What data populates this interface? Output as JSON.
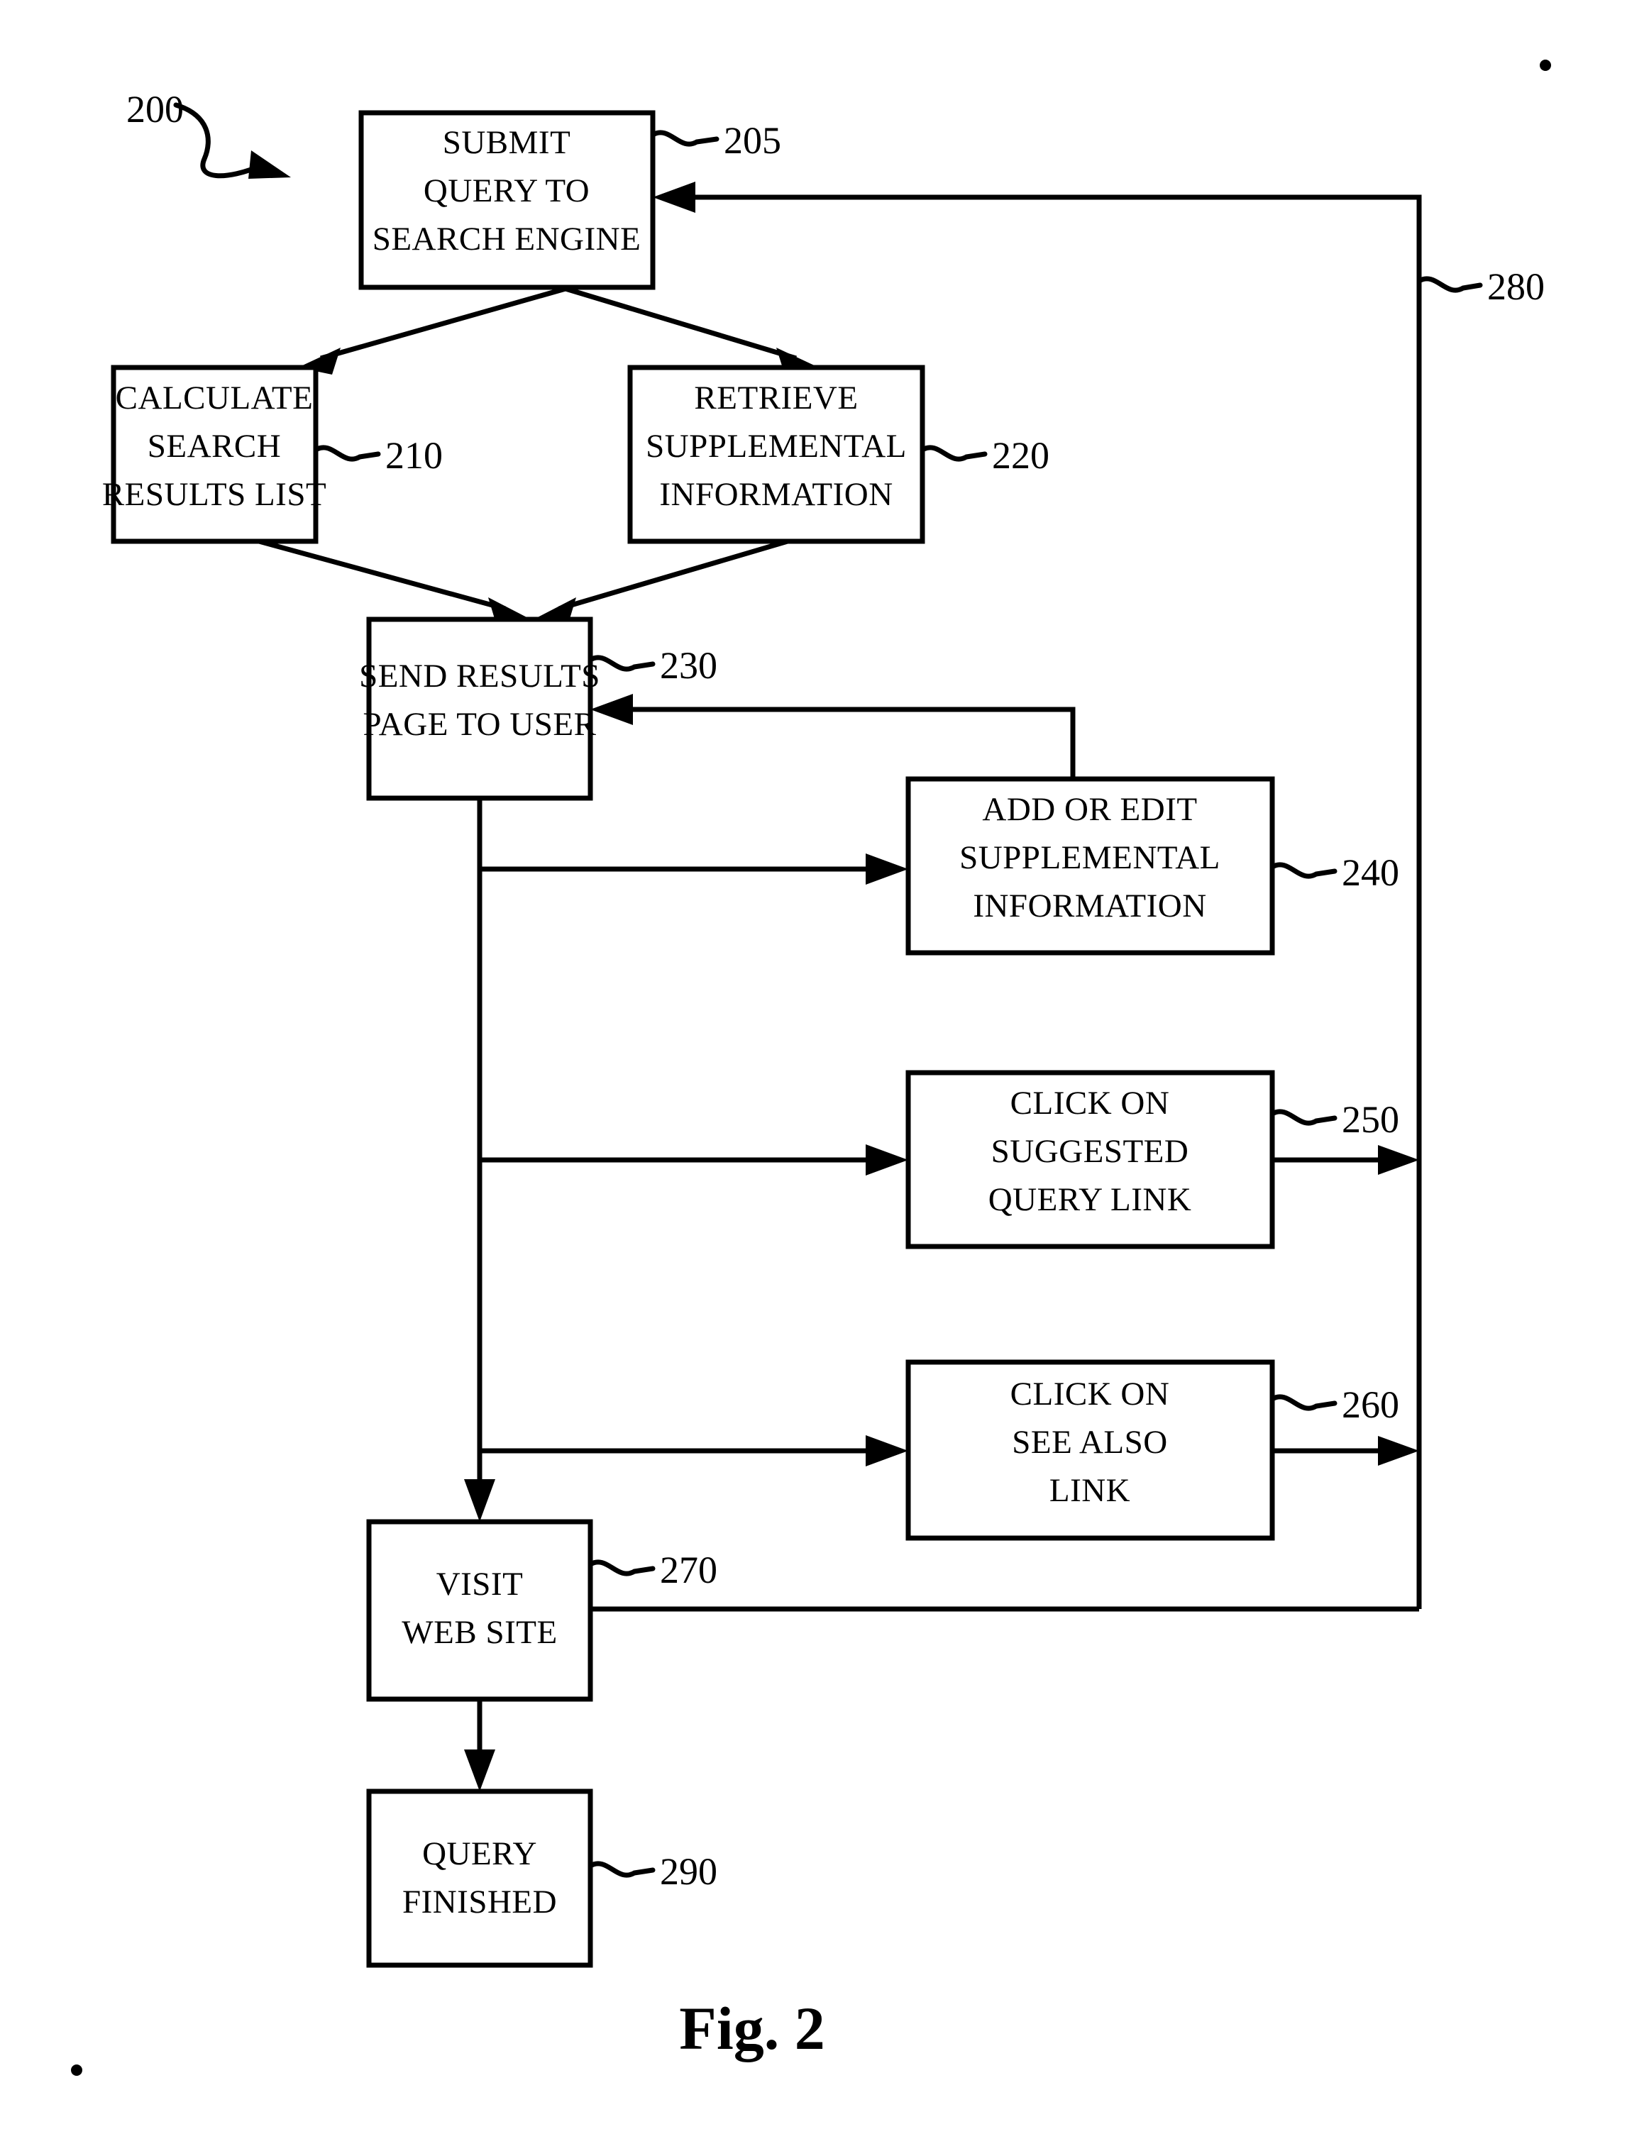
{
  "figure": {
    "caption": "Fig. 2",
    "diagram_label": "200",
    "title_text": "200"
  },
  "nodes": [
    {
      "id": "submit-query",
      "ref": "205",
      "lines": [
        "SUBMIT",
        "QUERY TO",
        "SEARCH ENGINE"
      ]
    },
    {
      "id": "calculate-search-results",
      "ref": "210",
      "lines": [
        "CALCULATE",
        "SEARCH",
        "RESULTS LIST"
      ]
    },
    {
      "id": "retrieve-supplemental",
      "ref": "220",
      "lines": [
        "RETRIEVE",
        "SUPPLEMENTAL",
        "INFORMATION"
      ]
    },
    {
      "id": "send-results-page",
      "ref": "230",
      "lines": [
        "SEND RESULTS",
        "PAGE TO USER"
      ]
    },
    {
      "id": "add-or-edit-supplemental",
      "ref": "240",
      "lines": [
        "ADD OR EDIT",
        "SUPPLEMENTAL",
        "INFORMATION"
      ]
    },
    {
      "id": "click-suggested-query-link",
      "ref": "250",
      "lines": [
        "CLICK ON",
        "SUGGESTED",
        "QUERY LINK"
      ]
    },
    {
      "id": "click-see-also-link",
      "ref": "260",
      "lines": [
        "CLICK ON",
        "SEE ALSO",
        "LINK"
      ]
    },
    {
      "id": "visit-web-site",
      "ref": "270",
      "lines": [
        "VISIT",
        "WEB SITE"
      ]
    },
    {
      "id": "query-finished",
      "ref": "290",
      "lines": [
        "QUERY",
        "FINISHED"
      ]
    }
  ],
  "edges": [
    {
      "id": "feedback-loop",
      "ref": "280"
    }
  ],
  "text": {
    "n205_l1": "SUBMIT",
    "n205_l2": "QUERY TO",
    "n205_l3": "SEARCH ENGINE",
    "n205_ref": "205",
    "n210_l1": "CALCULATE",
    "n210_l2": "SEARCH",
    "n210_l3": "RESULTS LIST",
    "n210_ref": "210",
    "n220_l1": "RETRIEVE",
    "n220_l2": "SUPPLEMENTAL",
    "n220_l3": "INFORMATION",
    "n220_ref": "220",
    "n230_l1": "SEND RESULTS",
    "n230_l2": "PAGE TO USER",
    "n230_ref": "230",
    "n240_l1": "ADD OR EDIT",
    "n240_l2": "SUPPLEMENTAL",
    "n240_l3": "INFORMATION",
    "n240_ref": "240",
    "n250_l1": "CLICK ON",
    "n250_l2": "SUGGESTED",
    "n250_l3": "QUERY LINK",
    "n250_ref": "250",
    "n260_l1": "CLICK ON",
    "n260_l2": "SEE ALSO",
    "n260_l3": "LINK",
    "n260_ref": "260",
    "n270_l1": "VISIT",
    "n270_l2": "WEB SITE",
    "n270_ref": "270",
    "n290_l1": "QUERY",
    "n290_l2": "FINISHED",
    "n290_ref": "290",
    "e280_ref": "280",
    "diagram_ref": "200",
    "caption": "Fig. 2"
  },
  "colors": {
    "ink": "#000000",
    "paper": "#ffffff"
  }
}
